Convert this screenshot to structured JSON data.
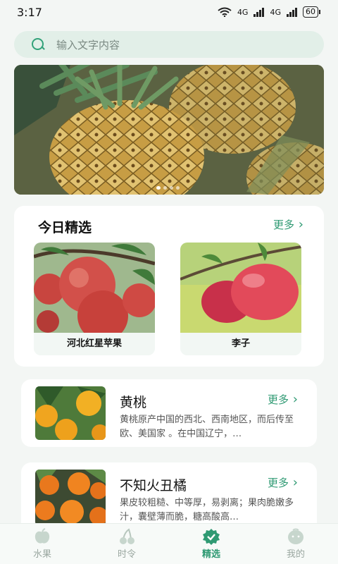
{
  "status": {
    "time": "3:17",
    "battery": "60",
    "net1": "4G",
    "net2": "4G"
  },
  "search": {
    "placeholder": "输入文字内容"
  },
  "banner": {
    "dots": 4,
    "active": 0
  },
  "today": {
    "title": "今日精选",
    "more": "更多",
    "items": [
      {
        "label": "河北红星苹果"
      },
      {
        "label": "李子"
      }
    ]
  },
  "fruits": [
    {
      "name": "黄桃",
      "more": "更多",
      "desc": "黄桃原产中国的西北、西南地区，而后传至欧、美国家 。在中国辽宁，…"
    },
    {
      "name": "不知火丑橘",
      "more": "更多",
      "desc": "果皮较粗糙、中等厚，易剥离；果肉脆嫩多汁，囊壁薄而脆，糖高酸高…"
    }
  ],
  "tabs": [
    {
      "label": "水果",
      "active": false
    },
    {
      "label": "时令",
      "active": false
    },
    {
      "label": "精选",
      "active": true
    },
    {
      "label": "我的",
      "active": false
    }
  ],
  "colors": {
    "accent": "#2f9a73",
    "search_bg": "#e2efe8",
    "background": "#f3f6f4"
  }
}
